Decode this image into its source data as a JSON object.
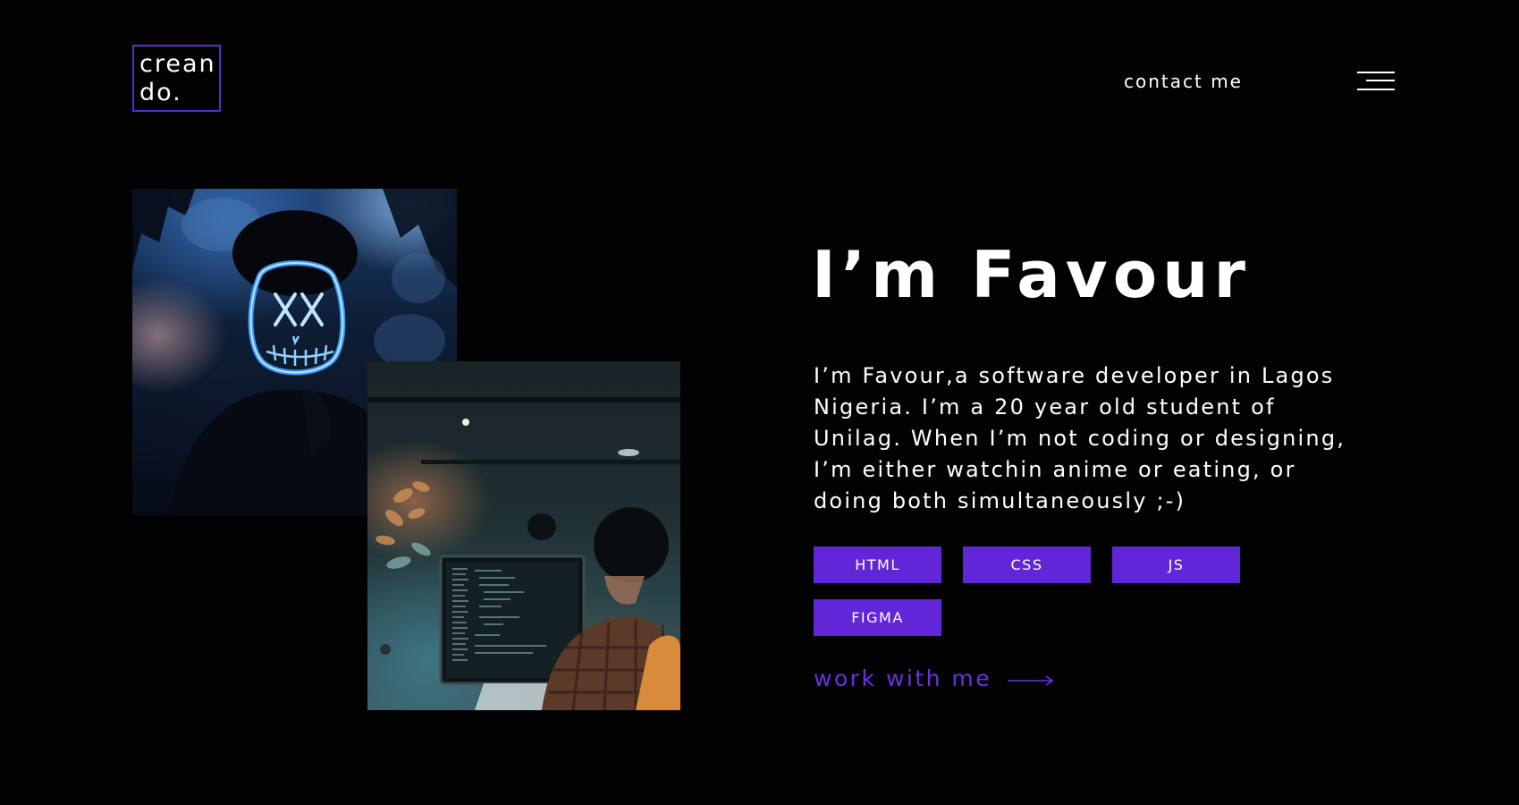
{
  "header": {
    "logo_line1": "crean",
    "logo_line2": "do.",
    "contact_label": "contact me",
    "menu_icon": "hamburger-menu-icon"
  },
  "hero": {
    "title": "I’m Favour",
    "bio": "I’m Favour,a software developer in Lagos Nigeria. I’m a 20 year old student of Unilag. When I’m not coding or designing, I’m either watchin anime or eating, or doing both simultaneously ;-)",
    "skills": [
      "HTML",
      "CSS",
      "JS",
      "FIGMA"
    ],
    "cta_label": "work with me",
    "cta_icon": "arrow-right-icon"
  },
  "colors": {
    "background": "#020202",
    "accent": "#6226d9",
    "text": "#ffffff"
  }
}
